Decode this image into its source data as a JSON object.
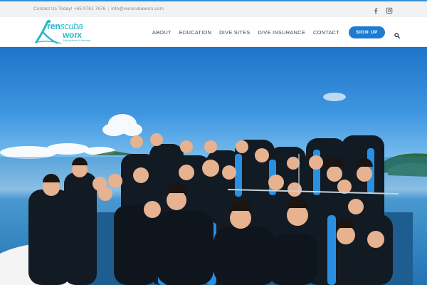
{
  "topbar": {
    "contact_text": "Contact Us Today! +65 9761 7676",
    "email": "info@renscubaworx.com",
    "social": [
      {
        "icon": "facebook-icon"
      },
      {
        "icon": "instagram-icon"
      }
    ]
  },
  "logo": {
    "brand_part1": "ren",
    "brand_part2": "scuba",
    "brand_part3": "worx",
    "tagline": "Making Waves & Memories"
  },
  "nav": {
    "items": [
      {
        "label": "ABOUT"
      },
      {
        "label": "EDUCATION"
      },
      {
        "label": "DIVE SITES"
      },
      {
        "label": "DIVE INSURANCE"
      },
      {
        "label": "CONTACT"
      }
    ],
    "signup_label": "SIGN UP",
    "search_icon": "search-icon"
  },
  "hero": {
    "image": "group-photo-of-divers-on-boat"
  },
  "colors": {
    "accent": "#1f7bd1",
    "brand": "#2ab7c8",
    "topbar_bg": "#f2f2f2"
  }
}
